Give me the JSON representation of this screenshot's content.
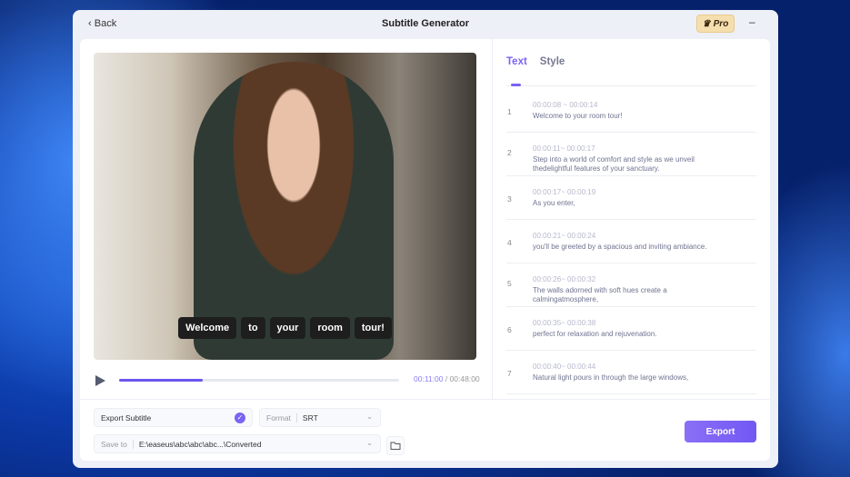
{
  "window": {
    "title": "Subtitle Generator",
    "back_label": "Back",
    "pro_label": "Pro",
    "minimize": "–"
  },
  "video": {
    "subtitle_words": [
      "Welcome",
      "to",
      "your",
      "room",
      "tour!"
    ],
    "current_time": "00:11:00",
    "total_time": "00:48:00",
    "progress_percent": 30
  },
  "tabs": [
    {
      "label": "Text",
      "active": true
    },
    {
      "label": "Style",
      "active": false
    }
  ],
  "subtitles": [
    {
      "index": "1",
      "time": "00:00:08 ~ 00:00:14",
      "text": "Welcome to your room tour!"
    },
    {
      "index": "2",
      "time": "00:00:11~ 00:00:17",
      "text": "Step into a world of comfort and style as we unveil thedelightful features of your sanctuary."
    },
    {
      "index": "3",
      "time": "00:00:17~ 00:00:19",
      "text": "As you enter,"
    },
    {
      "index": "4",
      "time": "00:00:21~ 00:00:24",
      "text": "you'll be greeted by a spacious and inviting ambiance."
    },
    {
      "index": "5",
      "time": "00:00:26~ 00:00:32",
      "text": "The walls adorned with soft hues create a calmingatmosphere,"
    },
    {
      "index": "6",
      "time": "00:00:35~ 00:00:38",
      "text": "perfect for relaxation and rejuvenation."
    },
    {
      "index": "7",
      "time": "00:00:40~ 00:00:44",
      "text": "Natural light pours in through the large windows,"
    }
  ],
  "export": {
    "export_subtitle_label": "Export Subtitle",
    "format_label": "Format",
    "format_value": "SRT",
    "save_to_label": "Save to",
    "save_path": "E:\\easeus\\abc\\abc\\abc...\\Converted",
    "export_button": "Export"
  },
  "colors": {
    "accent": "#7a63f5"
  }
}
